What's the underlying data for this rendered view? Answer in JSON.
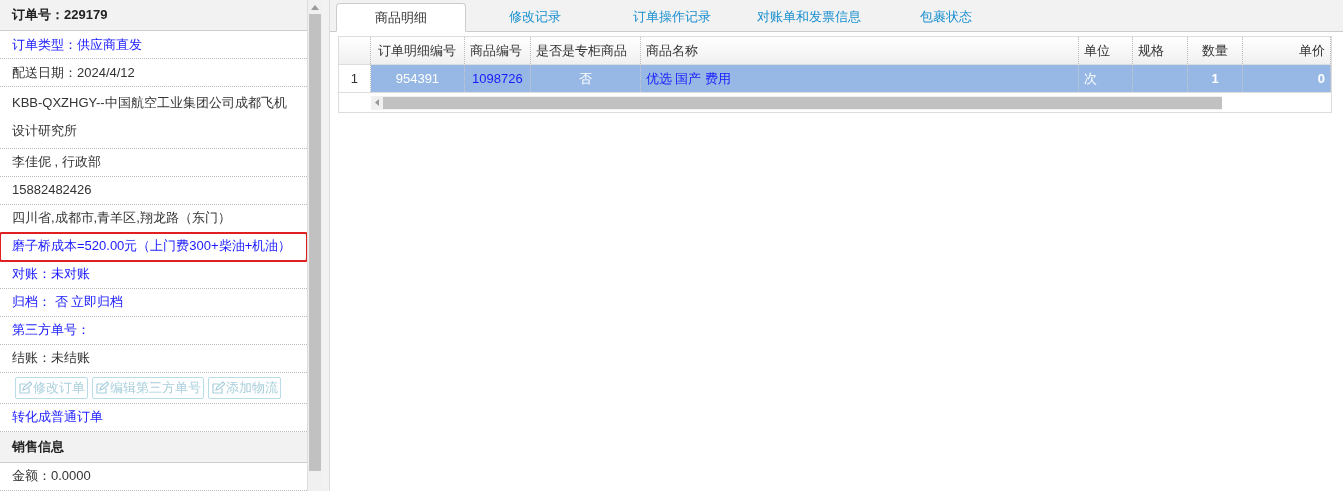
{
  "order_panel": {
    "title": "订单号：229179",
    "rows": [
      {
        "kind": "link",
        "text": "订单类型：供应商直发",
        "highlighted": false
      },
      {
        "kind": "text",
        "text": "配送日期：2024/4/12",
        "highlighted": false
      },
      {
        "kind": "text",
        "text": "KBB-QXZHGY--中国航空工业集团公司成都飞机设计研究所",
        "highlighted": false
      },
      {
        "kind": "text",
        "text": "李佳伲 , 行政部",
        "highlighted": false
      },
      {
        "kind": "text",
        "text": "15882482426",
        "highlighted": false
      },
      {
        "kind": "text",
        "text": "四川省,成都市,青羊区,翔龙路（东门）",
        "highlighted": false
      },
      {
        "kind": "link",
        "text": "磨子桥成本=520.00元（上门费300+柴油+机油）",
        "highlighted": true
      },
      {
        "kind": "link",
        "text": "对账：未对账",
        "highlighted": false
      },
      {
        "kind": "link",
        "text": "归档：  否 立即归档",
        "highlighted": false
      },
      {
        "kind": "link",
        "text": "第三方单号：",
        "highlighted": false
      },
      {
        "kind": "text",
        "text": "结账：未结账",
        "highlighted": false
      },
      {
        "kind": "buttons",
        "buttons": [
          {
            "label": "修改订单",
            "disabled": true
          },
          {
            "label": "编辑第三方单号",
            "disabled": true
          },
          {
            "label": "添加物流",
            "disabled": true
          }
        ]
      },
      {
        "kind": "link",
        "text": "转化成普通订单",
        "highlighted": false
      }
    ]
  },
  "sales_panel": {
    "title": "销售信息",
    "rows": [
      {
        "kind": "text",
        "text": "金额：0.0000",
        "highlighted": false
      }
    ]
  },
  "tabs": [
    {
      "label": "商品明细",
      "selected": true
    },
    {
      "label": "修改记录",
      "selected": false
    },
    {
      "label": "订单操作记录",
      "selected": false
    },
    {
      "label": "对账单和发票信息",
      "selected": false
    },
    {
      "label": "包裹状态",
      "selected": false
    }
  ],
  "table": {
    "columns": [
      "订单明细编号",
      "商品编号",
      "是否是专柜商品",
      "商品名称",
      "单位",
      "规格",
      "数量",
      "单价"
    ],
    "rows": [
      {
        "number": "1",
        "selected": true,
        "cells": [
          {
            "text": "954391",
            "color": "#ffffff"
          },
          {
            "text": "1098726",
            "color": "#1a1aff"
          },
          {
            "text": "否",
            "color": "#ffffff"
          },
          {
            "text": "优选 国产 费用",
            "color": "#1a1aff"
          },
          {
            "text": "次",
            "color": "#ffffff"
          },
          null,
          {
            "text": "1",
            "color": "#ffffff"
          },
          {
            "text": "0",
            "color": "#ffffff"
          }
        ]
      }
    ]
  }
}
